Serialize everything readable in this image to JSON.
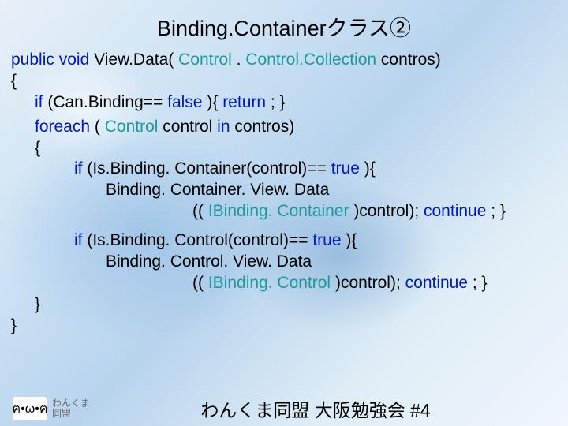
{
  "title": "Binding.Containerクラス②",
  "code": {
    "l1_kw1": "public",
    "l1_kw2": "void",
    "l1_rest": " View.Data(",
    "l1_typ1": "Control",
    "l1_dot": ". ",
    "l1_typ2": "Control.Collection",
    "l1_rest2": " contros)",
    "l2": "{",
    "l3_kw": "if",
    "l3_a": "(Can.Binding==",
    "l3_false": "false",
    "l3_b": "){",
    "l3_ret": "return",
    "l3_c": "; }",
    "l4_kw": "foreach",
    "l4_a": "(",
    "l4_typ": "Control",
    "l4_b": " control ",
    "l4_in": "in",
    "l4_c": " contros)",
    "l5": "{",
    "l6_kw": "if",
    "l6_a": "(Is.Binding. Container(control)==",
    "l6_true": "true",
    "l6_b": "){",
    "l7": "Binding. Container. View. Data",
    "l8_a": "((",
    "l8_typ": "IBinding. Container",
    "l8_b": ")control); ",
    "l8_cont": "continue",
    "l8_c": "; }",
    "l9_kw": "if",
    "l9_a": "(Is.Binding. Control(control)==",
    "l9_true": "true",
    "l9_b": "){",
    "l10": "Binding. Control. View. Data",
    "l11_a": "((",
    "l11_typ": "IBinding. Control",
    "l11_b": ")control); ",
    "l11_cont": "continue",
    "l11_c": "; }",
    "l12": "}",
    "l13": "}"
  },
  "footer": {
    "logo_emoji": "ฅ•ω•ฅ",
    "small1": "わんくま",
    "small2": "同盟",
    "main": "わんくま同盟 大阪勉強会 #4"
  }
}
